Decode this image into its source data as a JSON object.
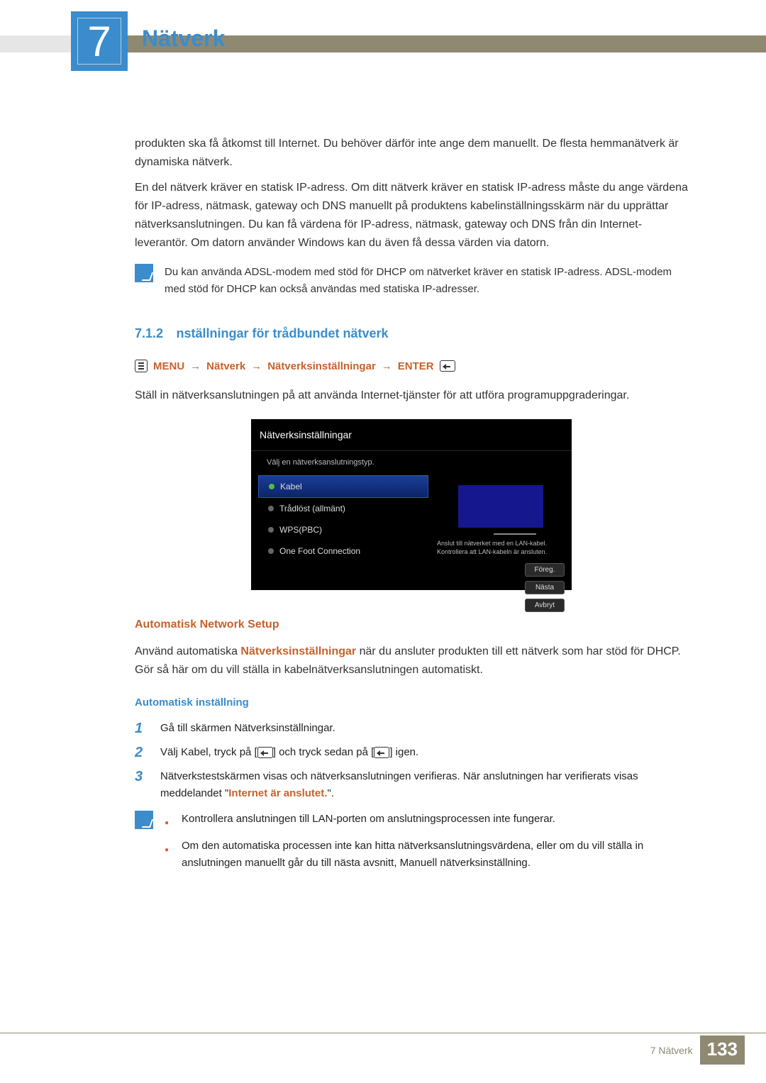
{
  "header": {
    "chapter_number": "7",
    "chapter_title": "Nätverk"
  },
  "intro": {
    "p1": "produkten ska få åtkomst till Internet. Du behöver därför inte ange dem manuellt. De flesta hemmanätverk är dynamiska nätverk.",
    "p2": "En del nätverk kräver en statisk IP-adress. Om ditt nätverk kräver en statisk IP-adress måste du ange värdena för IP-adress, nätmask, gateway och DNS manuellt på produktens kabelinställningsskärm när du upprättar nätverksanslutningen. Du kan få värdena för IP-adress, nätmask, gateway och DNS från din Internet-leverantör. Om datorn använder Windows kan du även få dessa värden via datorn.",
    "note": "Du kan använda ADSL-modem med stöd för DHCP om nätverket kräver en statisk IP-adress. ADSL-modem med stöd för DHCP kan också användas med statiska IP-adresser."
  },
  "section": {
    "num": "7.1.2",
    "title": "nställningar för trådbundet nätverk"
  },
  "nav": {
    "menu": "MENU",
    "p1": "Nätverk",
    "p2": "Nätverksinställningar",
    "enter": "ENTER"
  },
  "lead": "Ställ in nätverksanslutningen på att använda Internet-tjänster för att utföra programuppgraderingar.",
  "ui": {
    "title": "Nätverksinställningar",
    "sub": "Välj en nätverksanslutningstyp.",
    "items": [
      "Kabel",
      "Trådlöst (allmänt)",
      "WPS(PBC)",
      "One Foot Connection"
    ],
    "desc": "Anslut till nätverket med en LAN-kabel. Kontrollera att LAN-kabeln är ansluten.",
    "btns": [
      "Föreg.",
      "Nästa",
      "Avbryt"
    ]
  },
  "auto": {
    "h": "Automatisk Network Setup",
    "p_pre": "Använd automatiska ",
    "p_kw": "Nätverksinställningar",
    "p_post": " när du ansluter produkten till ett nätverk som har stöd för DHCP. Gör så här om du vill ställa in kabelnätverksanslutningen automatiskt.",
    "h2": "Automatisk inställning",
    "s1": "Gå till skärmen Nätverksinställningar.",
    "s2a": "Välj Kabel, tryck på [",
    "s2b": "] och tryck sedan på [",
    "s2c": "] igen.",
    "s3a": "Nätverkstestskärmen visas och nätverksanslutningen verifieras. När anslutningen har verifierats visas meddelandet \"",
    "s3kw": "Internet är anslutet.",
    "s3b": "\".",
    "b1": "Kontrollera anslutningen till LAN-porten om anslutningsprocessen inte fungerar.",
    "b2": "Om den automatiska processen inte kan hitta nätverksanslutningsvärdena, eller om du vill ställa in anslutningen manuellt går du till nästa avsnitt, Manuell nätverksinställning."
  },
  "footer": {
    "label": "7 Nätverk",
    "page": "133"
  }
}
